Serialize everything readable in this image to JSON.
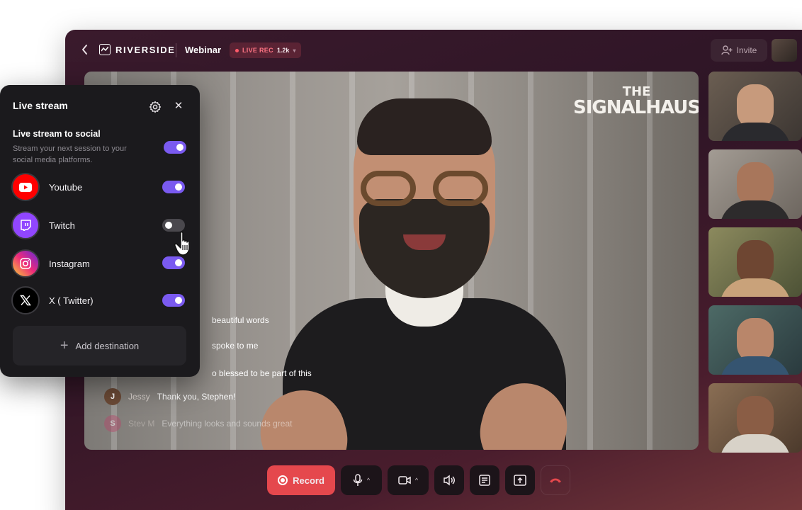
{
  "app": {
    "brand": "RIVERSIDE",
    "session_type": "Webinar",
    "live_badge": {
      "label": "LIVE REC",
      "count": "1.2k"
    },
    "invite_label": "Invite"
  },
  "stage": {
    "logo_line1": "THE",
    "logo_line2": "SIGNALHAUS"
  },
  "chat": [
    {
      "initial": "",
      "name": "",
      "text": "beautiful words",
      "color": "#3a3a3a"
    },
    {
      "initial": "",
      "name": "",
      "text": "spoke to me",
      "color": "#3a3a3a"
    },
    {
      "initial": "",
      "name": "",
      "text": "o blessed to be part of this",
      "color": "#1fa38e"
    },
    {
      "initial": "J",
      "name": "Jessy",
      "text": "Thank you, Stephen!",
      "color": "#6b4a36"
    },
    {
      "initial": "S",
      "name": "Stev M",
      "text": "Everything looks and sounds great",
      "color": "#b5486b"
    }
  ],
  "controls": {
    "record_label": "Record"
  },
  "panel": {
    "title": "Live stream",
    "section_title": "Live stream to social",
    "section_desc": "Stream your next session to your social media platforms.",
    "master_enabled": true,
    "destinations": [
      {
        "name": "Youtube",
        "icon": "youtube-icon",
        "enabled": true,
        "color": "#ff0000"
      },
      {
        "name": "Twitch",
        "icon": "twitch-icon",
        "enabled": false,
        "color": "#9146ff"
      },
      {
        "name": "Instagram",
        "icon": "instagram-icon",
        "enabled": true,
        "color": "#e1306c"
      },
      {
        "name": "X ( Twitter)",
        "icon": "x-icon",
        "enabled": true,
        "color": "#000000"
      }
    ],
    "add_destination_label": "Add destination"
  },
  "colors": {
    "accent": "#7a5af0",
    "record": "#e5484d",
    "hangup": "#e5484d"
  }
}
